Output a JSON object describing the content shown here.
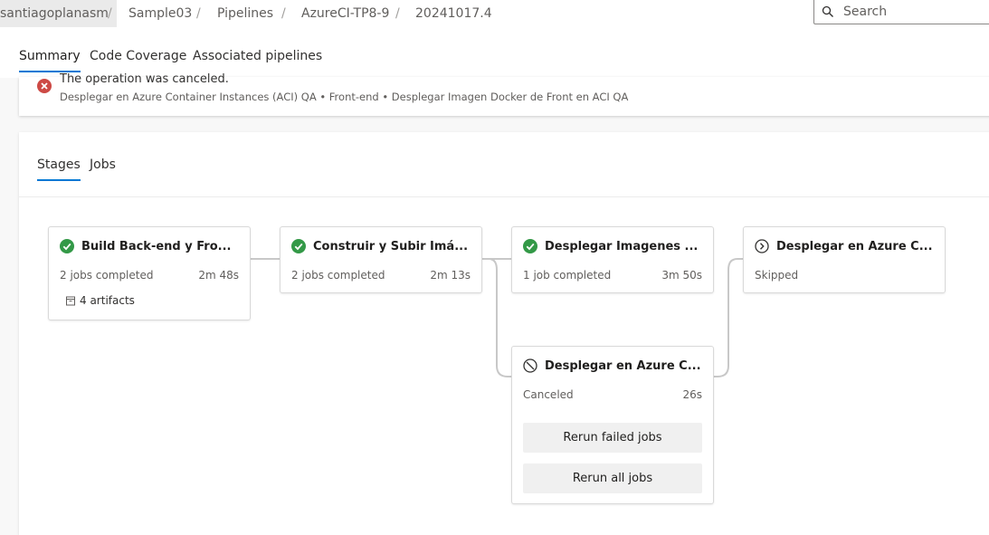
{
  "breadcrumb": {
    "org": "santiagoplanasm",
    "project": "Sample03",
    "section": "Pipelines",
    "pipeline": "AzureCI-TP8-9",
    "run": "20241017.4",
    "separator": "/"
  },
  "search": {
    "placeholder": "Search"
  },
  "tabs": {
    "summary": "Summary",
    "coverage": "Code Coverage",
    "associated": "Associated pipelines"
  },
  "banner": {
    "title": "The operation was canceled.",
    "detail": "Desplegar en Azure Container Instances (ACI) QA • Front-end • Desplegar Imagen Docker de Front en ACI QA"
  },
  "panel_tabs": {
    "stages": "Stages",
    "jobs": "Jobs"
  },
  "stages": [
    {
      "name": "Build Back-end y Fro...",
      "status": "2 jobs completed",
      "duration": "2m 48s",
      "artifacts": "4 artifacts",
      "state": "succeeded"
    },
    {
      "name": "Construir y Subir Imá...",
      "status": "2 jobs completed",
      "duration": "2m 13s",
      "state": "succeeded"
    },
    {
      "name": "Desplegar Imagenes ...",
      "status": "1 job completed",
      "duration": "3m 50s",
      "state": "succeeded"
    },
    {
      "name": "Desplegar en Azure C...",
      "status": "Skipped",
      "state": "skipped"
    },
    {
      "name": "Desplegar en Azure C...",
      "status": "Canceled",
      "duration": "26s",
      "state": "canceled",
      "actions": {
        "rerun_failed": "Rerun failed jobs",
        "rerun_all": "Rerun all jobs"
      }
    }
  ],
  "colors": {
    "success": "#339947",
    "error": "#cd4a45",
    "accent": "#0078d4",
    "neutral": "#605e5c"
  }
}
